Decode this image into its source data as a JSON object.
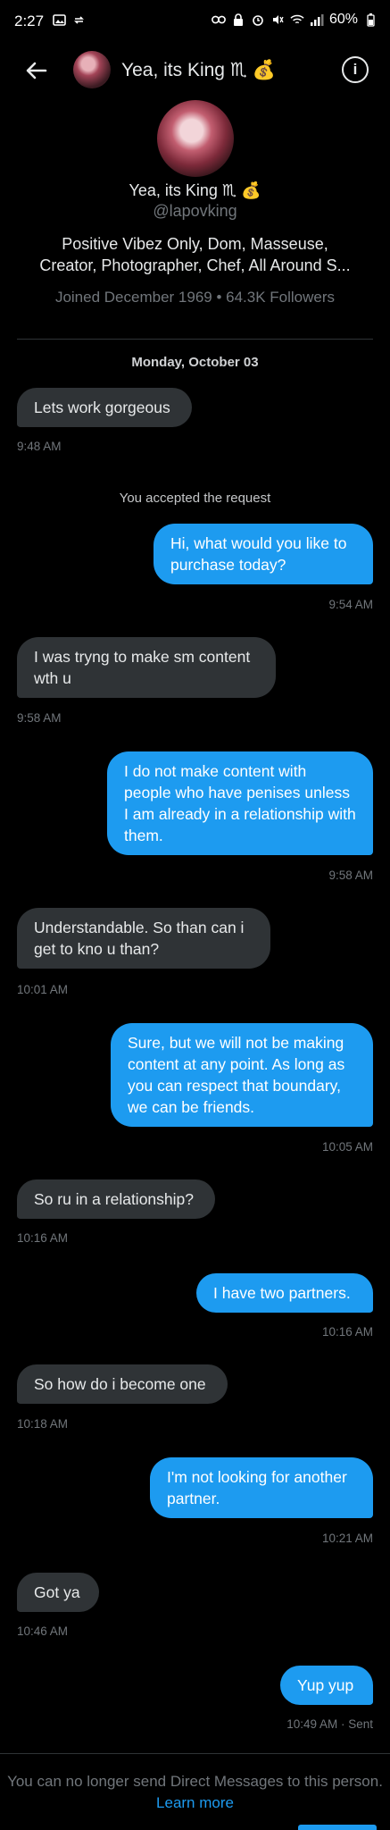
{
  "status_bar": {
    "time": "2:27",
    "battery": "60%"
  },
  "header": {
    "title": "Yea, its King ♏ 💰"
  },
  "profile": {
    "name": "Yea, its King ♏ 💰",
    "handle": "@lapovking",
    "bio_line1": "Positive Vibez Only, Dom, Masseuse,",
    "bio_line2": "Creator, Photographer, Chef, All Around S...",
    "meta": "Joined December 1969 • 64.3K Followers"
  },
  "conversation": {
    "day_label": "Monday, October 03",
    "system_note": "You accepted the request",
    "messages": [
      {
        "dir": "in",
        "text": "Lets work gorgeous",
        "time": "9:48 AM"
      },
      {
        "dir": "out",
        "text": "Hi, what would you like to purchase today?",
        "time": "9:54 AM"
      },
      {
        "dir": "in",
        "text": "I was tryng to make sm content wth u",
        "time": "9:58 AM"
      },
      {
        "dir": "out",
        "text": "I do not make content with people who have penises unless I am already in a relationship with them.",
        "time": "9:58 AM"
      },
      {
        "dir": "in",
        "text": "Understandable. So than can i get to kno u than?",
        "time": "10:01 AM"
      },
      {
        "dir": "out",
        "text": "Sure, but we will not be making content at any point. As long as you can respect that boundary, we can be friends.",
        "time": "10:05 AM"
      },
      {
        "dir": "in",
        "text": "So ru in a relationship?",
        "time": "10:16 AM"
      },
      {
        "dir": "out",
        "text": "I have two partners.",
        "time": "10:16 AM"
      },
      {
        "dir": "in",
        "text": "So how do i become one",
        "time": "10:18 AM"
      },
      {
        "dir": "out",
        "text": "I'm not looking for another partner.",
        "time": "10:21 AM"
      },
      {
        "dir": "in",
        "text": "Got ya",
        "time": "10:46 AM"
      },
      {
        "dir": "out",
        "text": "Yup yup",
        "time": "10:49 AM · Sent"
      }
    ]
  },
  "footer": {
    "text": "You can no longer send Direct Messages to this person.",
    "link": "Learn more"
  },
  "colors": {
    "bubble_out": "#1d9bf0",
    "bubble_in": "#2f3336",
    "background": "#000000"
  }
}
